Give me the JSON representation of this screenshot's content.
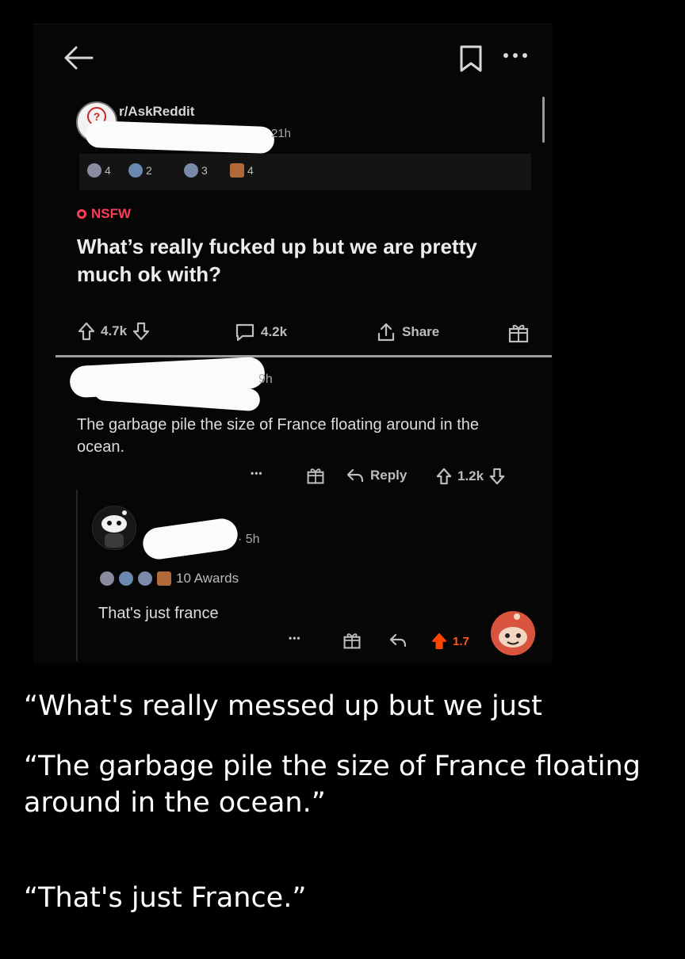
{
  "post": {
    "subreddit": "r/AskReddit",
    "time": "21h",
    "awards": [
      {
        "icon": "silver-award-icon",
        "count": "4",
        "color": "#8a8aa0"
      },
      {
        "icon": "helpful-award-icon",
        "count": "2",
        "color": "#6a88b0"
      },
      {
        "icon": "coin-award-icon",
        "count": "3",
        "color": "#7a8aaa"
      },
      {
        "icon": "gift-award-icon",
        "count": "4",
        "color": "#b06a3a"
      }
    ],
    "nsfw_label": "NSFW",
    "title": "What’s really fucked up but we are pretty much ok with?",
    "upvotes": "4.7k",
    "comments": "4.2k",
    "share_label": "Share"
  },
  "comment": {
    "time": "9h",
    "text": "The garbage pile the size of France floating around in the ocean.",
    "more": "•••",
    "reply_label": "Reply",
    "votes": "1.2k"
  },
  "reply": {
    "time": "· 5h",
    "awards_label": "10 Awards",
    "text": "That's just france",
    "more": "•••",
    "votes": "1.7"
  },
  "captions": {
    "line1": "“What's really messed up but we just",
    "line2": "“The garbage pile the size of France floating around in the ocean.”",
    "line3": "“That's just France.”"
  },
  "colors": {
    "nsfw": "#ff3d57",
    "upvote_active": "#ff4500",
    "background": "#000000"
  }
}
